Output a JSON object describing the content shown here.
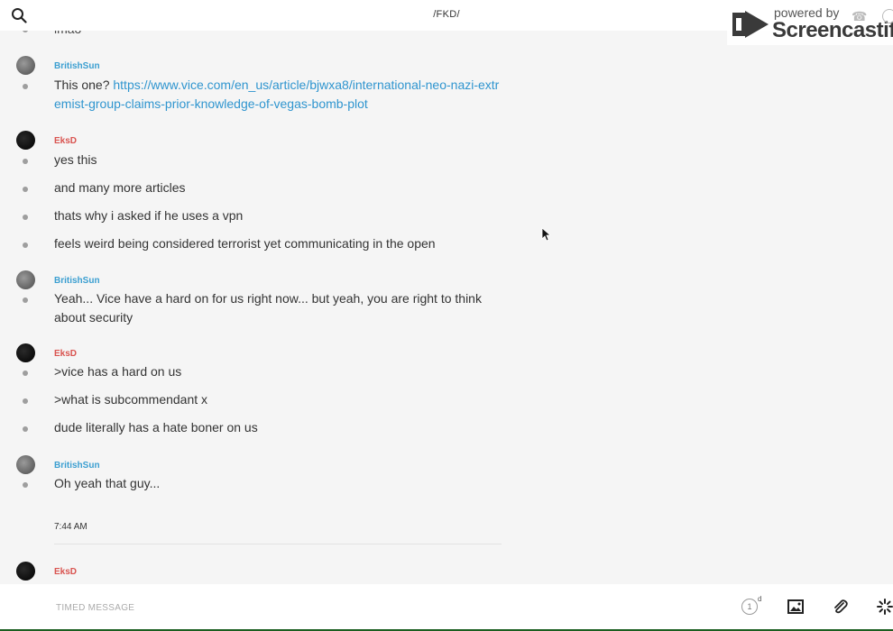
{
  "header": {
    "channel": "/FKD/",
    "watermark_top": "powered by",
    "watermark_brand": "Screencastify"
  },
  "messages": {
    "partial_line": "lmao",
    "group1": {
      "author": "BritishSun",
      "text_prefix": "This one? ",
      "link": "https://www.vice.com/en_us/article/bjwxa8/international-neo-nazi-extremist-group-claims-prior-knowledge-of-vegas-bomb-plot"
    },
    "group2": {
      "author": "EksD",
      "lines": [
        "yes this",
        "and many more articles",
        "thats why i asked if he uses a vpn",
        "feels weird being considered terrorist yet communicating in the open"
      ]
    },
    "group3": {
      "author": "BritishSun",
      "text": "Yeah... Vice have a hard on for us right now... but yeah, you are right to think about security"
    },
    "group4": {
      "author": "EksD",
      "lines": [
        ">vice has a hard on us",
        ">what is subcommendant x",
        "dude literally has a hate boner on us"
      ]
    },
    "group5": {
      "author": "BritishSun",
      "text": "Oh yeah that guy..."
    },
    "timestamp": "7:44 AM",
    "group6": {
      "author": "EksD"
    }
  },
  "composer": {
    "placeholder": "TIMED MESSAGE",
    "timer_value": "1",
    "timer_unit": "d"
  },
  "colors": {
    "link": "#2f95cf",
    "author_blue": "#3b9fd1",
    "author_red": "#d9534f"
  }
}
